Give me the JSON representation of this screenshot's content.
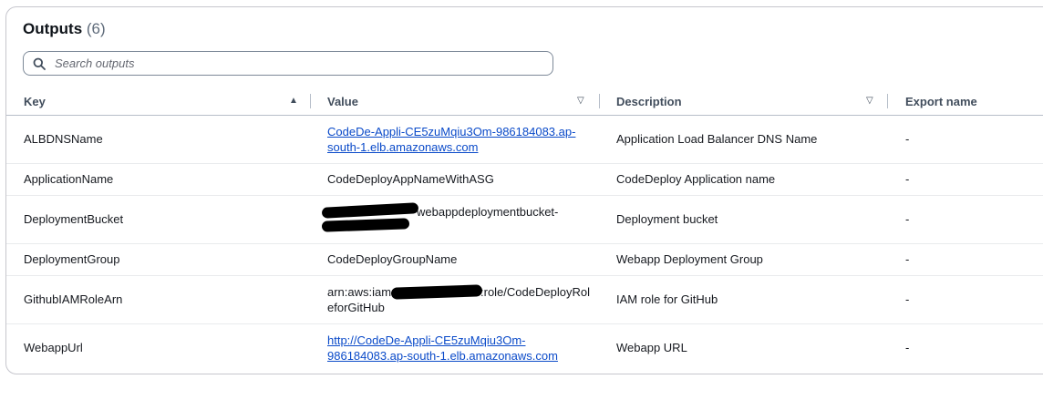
{
  "outputs": {
    "title": "Outputs",
    "count": "(6)",
    "search_placeholder": "Search outputs",
    "columns": {
      "key": "Key",
      "value": "Value",
      "description": "Description",
      "export_name": "Export name"
    },
    "rows": [
      {
        "key": "ALBDNSName",
        "value": "CodeDe-Appli-CE5zuMqiu3Om-986184083.ap-south-1.elb.amazonaws.com",
        "value_line1": "CodeDe-Appli-CE5zuMqiu3Om-986184083.ap-",
        "value_line2": "south-1.elb.amazonaws.com",
        "description": "Application Load Balancer DNS Name",
        "export_name": "-"
      },
      {
        "key": "ApplicationName",
        "value": "CodeDeployAppNameWithASG",
        "description": "CodeDeploy Application name",
        "export_name": "-"
      },
      {
        "key": "DeploymentBucket",
        "value_visible": "webappdeploymentbucket-",
        "description": "Deployment bucket",
        "export_name": "-"
      },
      {
        "key": "DeploymentGroup",
        "value": "CodeDeployGroupName",
        "description": "Webapp Deployment Group",
        "export_name": "-"
      },
      {
        "key": "GithubIAMRoleArn",
        "value_part1": "arn:aws:iam:",
        "value_part2": ":role/CodeDeployRol",
        "value_line2": "eforGitHub",
        "description": "IAM role for GitHub",
        "export_name": "-"
      },
      {
        "key": "WebappUrl",
        "value": "http://CodeDe-Appli-CE5zuMqiu3Om-986184083.ap-south-1.elb.amazonaws.com",
        "value_line1": "http://CodeDe-Appli-CE5zuMqiu3Om-",
        "value_line2": "986184083.ap-south-1.elb.amazonaws.com",
        "description": "Webapp URL",
        "export_name": "-"
      }
    ]
  }
}
